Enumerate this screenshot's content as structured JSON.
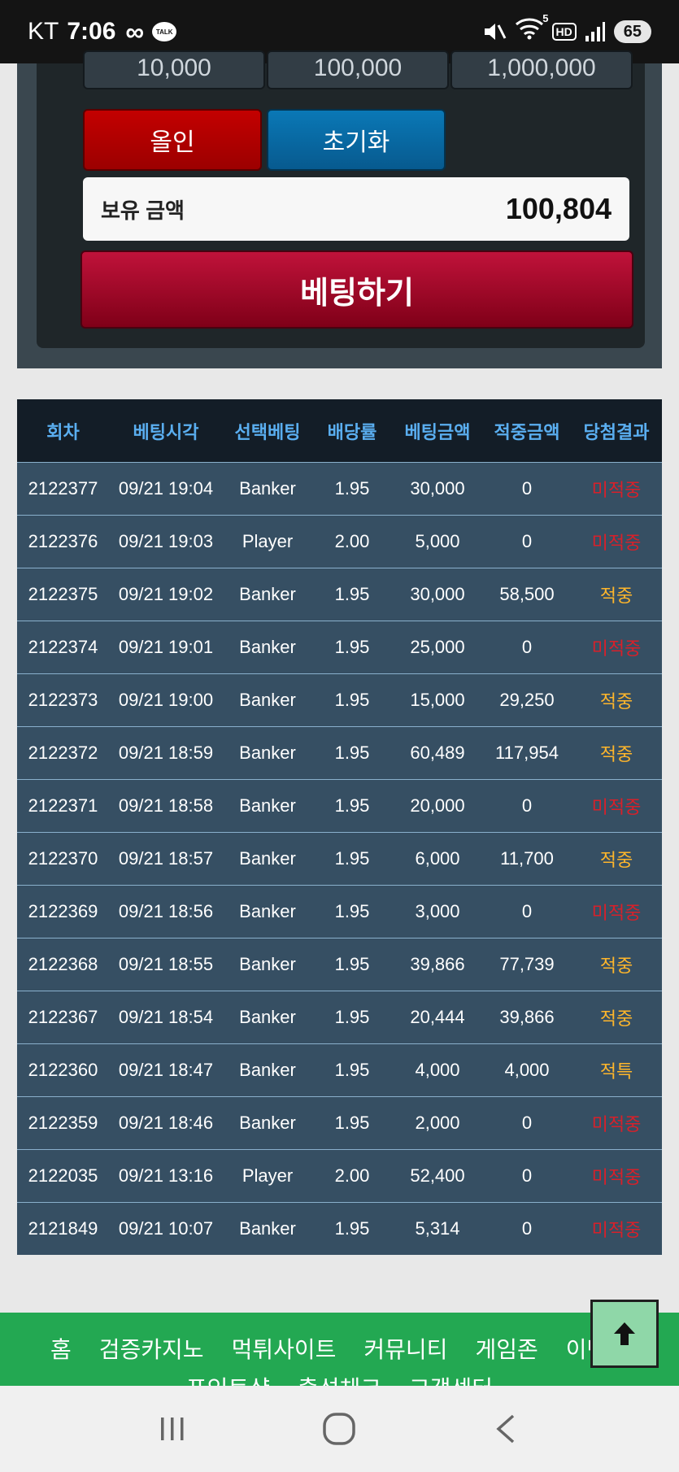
{
  "status_bar": {
    "carrier": "KT",
    "time": "7:06",
    "talk_badge": "TALK",
    "hd_badge": "HD",
    "wifi_badge": "5",
    "battery": "65"
  },
  "bet_panel": {
    "chips": [
      "10,000",
      "100,000",
      "1,000,000"
    ],
    "allin_label": "올인",
    "reset_label": "초기화",
    "balance_label": "보유 금액",
    "balance_value": "100,804",
    "bet_label": "베팅하기"
  },
  "history": {
    "columns": [
      "회차",
      "베팅시각",
      "선택베팅",
      "배당률",
      "베팅금액",
      "적중금액",
      "당첨결과"
    ],
    "rows": [
      {
        "round": "2122377",
        "time": "09/21 19:04",
        "pick": "Banker",
        "odds": "1.95",
        "bet": "30,000",
        "win": "0",
        "result": "미적중",
        "status": "lose"
      },
      {
        "round": "2122376",
        "time": "09/21 19:03",
        "pick": "Player",
        "odds": "2.00",
        "bet": "5,000",
        "win": "0",
        "result": "미적중",
        "status": "lose"
      },
      {
        "round": "2122375",
        "time": "09/21 19:02",
        "pick": "Banker",
        "odds": "1.95",
        "bet": "30,000",
        "win": "58,500",
        "result": "적중",
        "status": "win"
      },
      {
        "round": "2122374",
        "time": "09/21 19:01",
        "pick": "Banker",
        "odds": "1.95",
        "bet": "25,000",
        "win": "0",
        "result": "미적중",
        "status": "lose"
      },
      {
        "round": "2122373",
        "time": "09/21 19:00",
        "pick": "Banker",
        "odds": "1.95",
        "bet": "15,000",
        "win": "29,250",
        "result": "적중",
        "status": "win"
      },
      {
        "round": "2122372",
        "time": "09/21 18:59",
        "pick": "Banker",
        "odds": "1.95",
        "bet": "60,489",
        "win": "117,954",
        "result": "적중",
        "status": "win"
      },
      {
        "round": "2122371",
        "time": "09/21 18:58",
        "pick": "Banker",
        "odds": "1.95",
        "bet": "20,000",
        "win": "0",
        "result": "미적중",
        "status": "lose"
      },
      {
        "round": "2122370",
        "time": "09/21 18:57",
        "pick": "Banker",
        "odds": "1.95",
        "bet": "6,000",
        "win": "11,700",
        "result": "적중",
        "status": "win"
      },
      {
        "round": "2122369",
        "time": "09/21 18:56",
        "pick": "Banker",
        "odds": "1.95",
        "bet": "3,000",
        "win": "0",
        "result": "미적중",
        "status": "lose"
      },
      {
        "round": "2122368",
        "time": "09/21 18:55",
        "pick": "Banker",
        "odds": "1.95",
        "bet": "39,866",
        "win": "77,739",
        "result": "적중",
        "status": "win"
      },
      {
        "round": "2122367",
        "time": "09/21 18:54",
        "pick": "Banker",
        "odds": "1.95",
        "bet": "20,444",
        "win": "39,866",
        "result": "적중",
        "status": "win"
      },
      {
        "round": "2122360",
        "time": "09/21 18:47",
        "pick": "Banker",
        "odds": "1.95",
        "bet": "4,000",
        "win": "4,000",
        "result": "적특",
        "status": "win"
      },
      {
        "round": "2122359",
        "time": "09/21 18:46",
        "pick": "Banker",
        "odds": "1.95",
        "bet": "2,000",
        "win": "0",
        "result": "미적중",
        "status": "lose"
      },
      {
        "round": "2122035",
        "time": "09/21 13:16",
        "pick": "Player",
        "odds": "2.00",
        "bet": "52,400",
        "win": "0",
        "result": "미적중",
        "status": "lose"
      },
      {
        "round": "2121849",
        "time": "09/21 10:07",
        "pick": "Banker",
        "odds": "1.95",
        "bet": "5,314",
        "win": "0",
        "result": "미적중",
        "status": "lose"
      }
    ]
  },
  "footer_nav": {
    "items": [
      "홈",
      "검증카지노",
      "먹튀사이트",
      "커뮤니티",
      "게임존",
      "이벤트"
    ],
    "items_row2": [
      "포인트샵",
      "출석체크",
      "고객센터"
    ]
  },
  "colors": {
    "header_text": "#5aaef0",
    "win": "#ffb62b",
    "lose": "#d8202a",
    "footer_bg": "#23a852"
  },
  "icons": {
    "scroll_top": "arrow-up-icon",
    "nav_recent": "recent-apps-icon",
    "nav_home": "home-circle-icon",
    "nav_back": "back-chevron-icon"
  }
}
